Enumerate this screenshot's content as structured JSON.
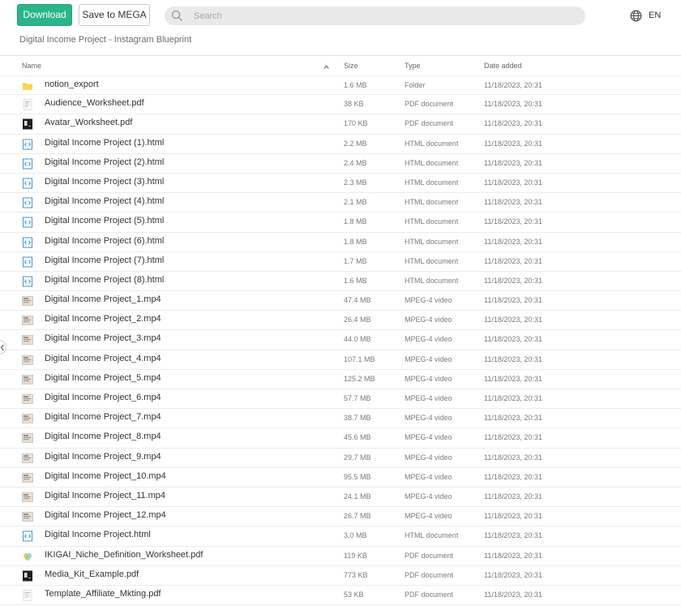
{
  "toolbar": {
    "download_label": "Download",
    "save_mega_label": "Save to MEGA",
    "search_placeholder": "Search",
    "language": "EN"
  },
  "breadcrumb": "Digital Income Project - Instagram Blueprint",
  "columns": {
    "name": "Name",
    "size": "Size",
    "type": "Type",
    "date": "Date added"
  },
  "colors": {
    "accent": "#2bb58a",
    "html_icon": "#3f93d9",
    "folder": "#f7c64a"
  },
  "files": [
    {
      "icon": "folder-icon",
      "name": "notion_export",
      "size": "1.6 MB",
      "type": "Folder",
      "date": "11/18/2023, 20:31"
    },
    {
      "icon": "pdf-light-thumbnail-icon",
      "name": "Audience_Worksheet.pdf",
      "size": "38 KB",
      "type": "PDF document",
      "date": "11/18/2023, 20:31"
    },
    {
      "icon": "pdf-dark-thumbnail-icon",
      "name": "Avatar_Worksheet.pdf",
      "size": "170 KB",
      "type": "PDF document",
      "date": "11/18/2023, 20:31"
    },
    {
      "icon": "html-file-icon",
      "name": "Digital Income Project (1).html",
      "size": "2.2 MB",
      "type": "HTML document",
      "date": "11/18/2023, 20:31"
    },
    {
      "icon": "html-file-icon",
      "name": "Digital Income Project (2).html",
      "size": "2.4 MB",
      "type": "HTML document",
      "date": "11/18/2023, 20:31"
    },
    {
      "icon": "html-file-icon",
      "name": "Digital Income Project (3).html",
      "size": "2.3 MB",
      "type": "HTML document",
      "date": "11/18/2023, 20:31"
    },
    {
      "icon": "html-file-icon",
      "name": "Digital Income Project (4).html",
      "size": "2.1 MB",
      "type": "HTML document",
      "date": "11/18/2023, 20:31"
    },
    {
      "icon": "html-file-icon",
      "name": "Digital Income Project (5).html",
      "size": "1.8 MB",
      "type": "HTML document",
      "date": "11/18/2023, 20:31"
    },
    {
      "icon": "html-file-icon",
      "name": "Digital Income Project (6).html",
      "size": "1.8 MB",
      "type": "HTML document",
      "date": "11/18/2023, 20:31"
    },
    {
      "icon": "html-file-icon",
      "name": "Digital Income Project (7).html",
      "size": "1.7 MB",
      "type": "HTML document",
      "date": "11/18/2023, 20:31"
    },
    {
      "icon": "html-file-icon",
      "name": "Digital Income Project (8).html",
      "size": "1.6 MB",
      "type": "HTML document",
      "date": "11/18/2023, 20:31"
    },
    {
      "icon": "video-thumbnail-icon",
      "name": "Digital Income Project_1.mp4",
      "size": "47.4 MB",
      "type": "MPEG-4 video",
      "date": "11/18/2023, 20:31"
    },
    {
      "icon": "video-thumbnail-icon",
      "name": "Digital Income Project_2.mp4",
      "size": "26.4 MB",
      "type": "MPEG-4 video",
      "date": "11/18/2023, 20:31"
    },
    {
      "icon": "video-thumbnail-icon",
      "name": "Digital Income Project_3.mp4",
      "size": "44.0 MB",
      "type": "MPEG-4 video",
      "date": "11/18/2023, 20:31"
    },
    {
      "icon": "video-thumbnail-icon",
      "name": "Digital Income Project_4.mp4",
      "size": "107.1 MB",
      "type": "MPEG-4 video",
      "date": "11/18/2023, 20:31"
    },
    {
      "icon": "video-thumbnail-icon",
      "name": "Digital Income Project_5.mp4",
      "size": "125.2 MB",
      "type": "MPEG-4 video",
      "date": "11/18/2023, 20:31"
    },
    {
      "icon": "video-thumbnail-icon",
      "name": "Digital Income Project_6.mp4",
      "size": "57.7 MB",
      "type": "MPEG-4 video",
      "date": "11/18/2023, 20:31"
    },
    {
      "icon": "video-thumbnail-icon",
      "name": "Digital Income Project_7.mp4",
      "size": "38.7 MB",
      "type": "MPEG-4 video",
      "date": "11/18/2023, 20:31"
    },
    {
      "icon": "video-thumbnail-icon",
      "name": "Digital Income Project_8.mp4",
      "size": "45.6 MB",
      "type": "MPEG-4 video",
      "date": "11/18/2023, 20:31"
    },
    {
      "icon": "video-thumbnail-icon",
      "name": "Digital Income Project_9.mp4",
      "size": "29.7 MB",
      "type": "MPEG-4 video",
      "date": "11/18/2023, 20:31"
    },
    {
      "icon": "video-thumbnail-icon",
      "name": "Digital Income Project_10.mp4",
      "size": "95.5 MB",
      "type": "MPEG-4 video",
      "date": "11/18/2023, 20:31"
    },
    {
      "icon": "video-thumbnail-icon",
      "name": "Digital Income Project_11.mp4",
      "size": "24.1 MB",
      "type": "MPEG-4 video",
      "date": "11/18/2023, 20:31"
    },
    {
      "icon": "video-thumbnail-icon",
      "name": "Digital Income Project_12.mp4",
      "size": "26.7 MB",
      "type": "MPEG-4 video",
      "date": "11/18/2023, 20:31"
    },
    {
      "icon": "html-file-icon",
      "name": "Digital Income Project.html",
      "size": "3.0 MB",
      "type": "HTML document",
      "date": "11/18/2023, 20:31"
    },
    {
      "icon": "pdf-color-thumbnail-icon",
      "name": "IKIGAI_Niche_Definition_Worksheet.pdf",
      "size": "119 KB",
      "type": "PDF document",
      "date": "11/18/2023, 20:31"
    },
    {
      "icon": "pdf-dark-thumbnail-icon",
      "name": "Media_Kit_Example.pdf",
      "size": "773 KB",
      "type": "PDF document",
      "date": "11/18/2023, 20:31"
    },
    {
      "icon": "pdf-light-thumbnail-icon",
      "name": "Template_Affiliate_Mkting.pdf",
      "size": "53 KB",
      "type": "PDF document",
      "date": "11/18/2023, 20:31"
    }
  ]
}
